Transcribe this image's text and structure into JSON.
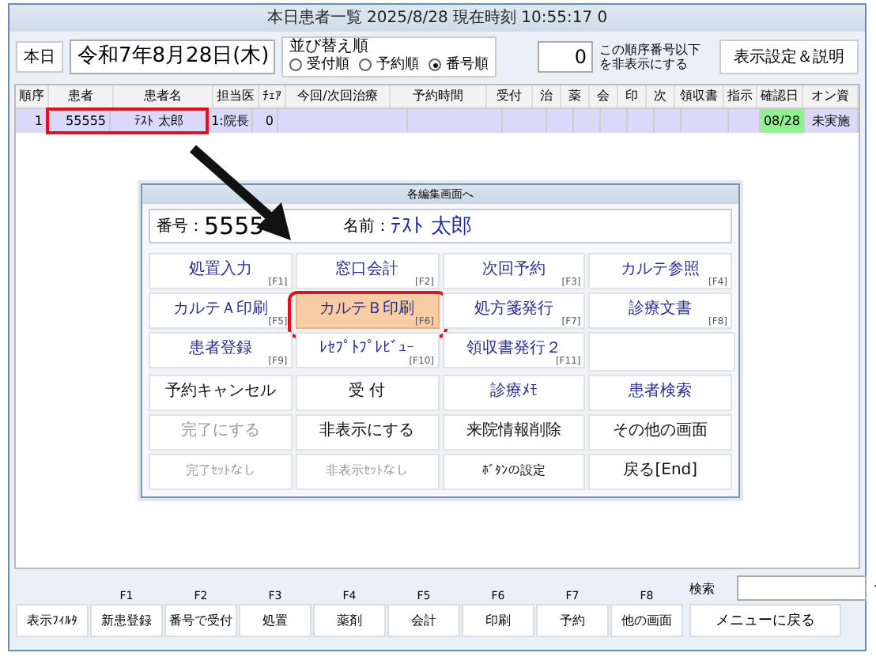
{
  "window": {
    "title": "本日患者一覧 2025/8/28  現在時刻 10:55:17 0"
  },
  "toolbar": {
    "today_button": "本日",
    "date": "令和7年8月28日(木)",
    "sort": {
      "label": "並び替え順",
      "options": [
        {
          "label": "受付順",
          "selected": false
        },
        {
          "label": "予約順",
          "selected": false
        },
        {
          "label": "番号順",
          "selected": true
        }
      ]
    },
    "hide_number": {
      "value": "0",
      "note": "この順序番号以下を非表示にする"
    },
    "settings_button": "表示設定＆説明"
  },
  "table": {
    "columns": [
      "順序",
      "患者",
      "患者名",
      "担当医",
      "ﾁｪｱ",
      "今回/次回治療",
      "予約時間",
      "受付",
      "治",
      "薬",
      "会",
      "印",
      "次",
      "領収書",
      "指示",
      "確認日",
      "オン資"
    ],
    "rows": [
      {
        "selected": true,
        "cells": [
          "1",
          "55555",
          "ﾃｽﾄ 太郎",
          "1:院長",
          "0",
          "",
          "",
          "",
          "",
          "",
          "",
          "",
          "",
          "",
          "",
          "08/28",
          "未実施"
        ]
      }
    ]
  },
  "dialog": {
    "title": "各編集画面へ",
    "number_label": "番号：",
    "number": "5555",
    "name_label": "名前：",
    "name": "ﾃｽﾄ 太郎",
    "buttons": [
      {
        "kind": "blue",
        "label": "処置入力",
        "key": "[F1]",
        "disabled": false,
        "highlighted": false
      },
      {
        "kind": "blue",
        "label": "窓口会計",
        "key": "[F2]",
        "disabled": false,
        "highlighted": false
      },
      {
        "kind": "blue",
        "label": "次回予約",
        "key": "[F3]",
        "disabled": false,
        "highlighted": false
      },
      {
        "kind": "blue",
        "label": "カルテ参照",
        "key": "[F4]",
        "disabled": false,
        "highlighted": false
      },
      {
        "kind": "blue",
        "label": "カルテＡ印刷",
        "key": "[F5]",
        "disabled": false,
        "highlighted": false
      },
      {
        "kind": "blue",
        "label": "カルテＢ印刷",
        "key": "[F6]",
        "disabled": false,
        "highlighted": true
      },
      {
        "kind": "blue",
        "label": "処方箋発行",
        "key": "[F7]",
        "disabled": false,
        "highlighted": false
      },
      {
        "kind": "blue",
        "label": "診療文書",
        "key": "[F8]",
        "disabled": false,
        "highlighted": false
      },
      {
        "kind": "blue",
        "label": "患者登録",
        "key": "[F9]",
        "disabled": false,
        "highlighted": false
      },
      {
        "kind": "blue",
        "label": "ﾚｾﾌﾟﾄﾌﾟﾚﾋﾞｭｰ",
        "key": "[F10]",
        "disabled": false,
        "highlighted": false
      },
      {
        "kind": "blue",
        "label": "領収書発行２",
        "key": "[F11]",
        "disabled": false,
        "highlighted": false
      },
      {
        "kind": "blank"
      },
      {
        "kind": "black",
        "label": "予約キャンセル",
        "disabled": false,
        "highlighted": false
      },
      {
        "kind": "black",
        "label": "受 付",
        "disabled": false,
        "highlighted": false
      },
      {
        "kind": "blue",
        "label": "診療ﾒﾓ",
        "disabled": false,
        "highlighted": false
      },
      {
        "kind": "blue",
        "label": "患者検索",
        "disabled": false,
        "highlighted": false
      },
      {
        "kind": "black",
        "label": "完了にする",
        "disabled": true,
        "highlighted": false
      },
      {
        "kind": "black",
        "label": "非表示にする",
        "disabled": false,
        "highlighted": false
      },
      {
        "kind": "black",
        "label": "来院情報削除",
        "disabled": false,
        "highlighted": false
      },
      {
        "kind": "black",
        "label": "その他の画面",
        "disabled": false,
        "highlighted": false
      },
      {
        "kind": "small",
        "label": "完了ｾｯﾄなし",
        "disabled": true,
        "highlighted": false
      },
      {
        "kind": "small",
        "label": "非表示ｾｯﾄなし",
        "disabled": true,
        "highlighted": false
      },
      {
        "kind": "small",
        "label": "ﾎﾞﾀﾝの設定",
        "disabled": false,
        "highlighted": false
      },
      {
        "kind": "black",
        "label": "戻る[End]",
        "disabled": false,
        "highlighted": false
      }
    ]
  },
  "footer": {
    "buttons": [
      {
        "label": "表示ﾌｨﾙﾀ"
      },
      {
        "key": "F1",
        "label": "新患登録"
      },
      {
        "key": "F2",
        "label": "番号で受付"
      },
      {
        "key": "F3",
        "label": "処置"
      },
      {
        "key": "F4",
        "label": "薬剤"
      },
      {
        "key": "F5",
        "label": "会計"
      },
      {
        "key": "F6",
        "label": "印刷"
      },
      {
        "key": "F7",
        "label": "予約"
      },
      {
        "key": "F8",
        "label": "他の画面"
      }
    ],
    "search_label": "検索",
    "menu_button": "メニューに戻る"
  }
}
